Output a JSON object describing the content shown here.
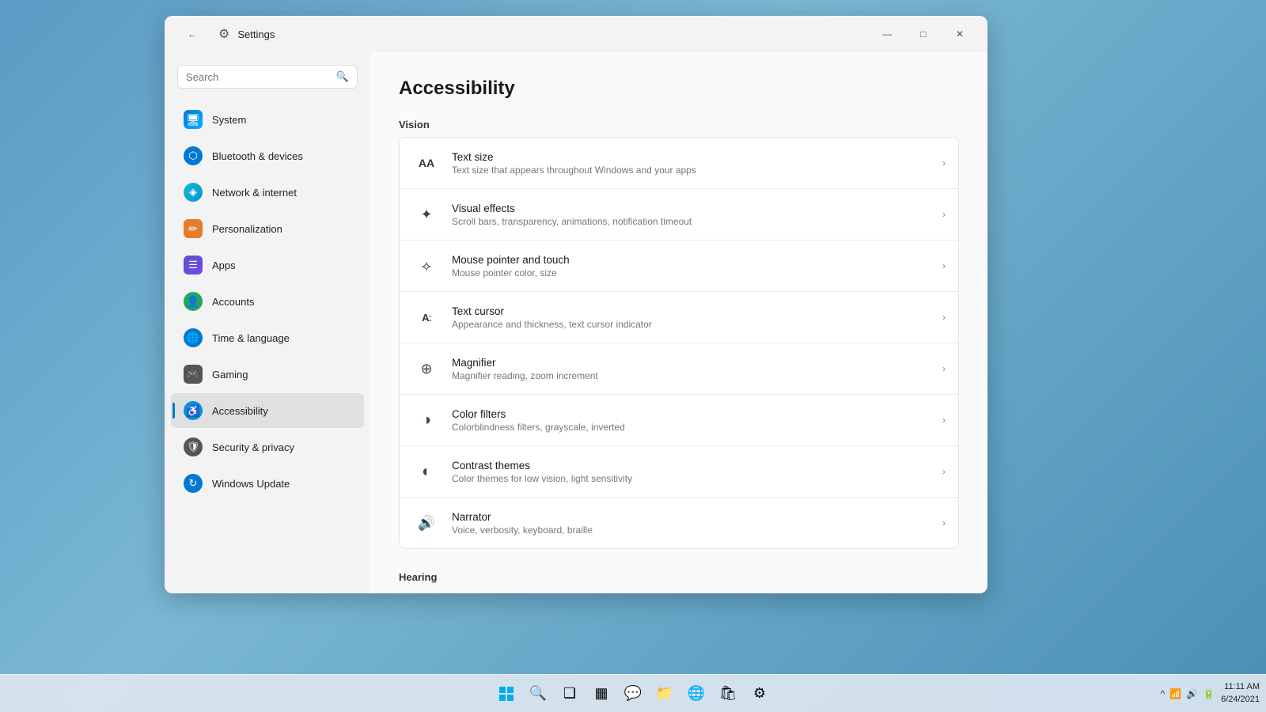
{
  "window": {
    "title": "Settings",
    "controls": {
      "minimize": "—",
      "maximize": "□",
      "close": "✕"
    }
  },
  "sidebar": {
    "search_placeholder": "Search",
    "items": [
      {
        "id": "system",
        "label": "System",
        "icon": "🖥"
      },
      {
        "id": "bluetooth",
        "label": "Bluetooth & devices",
        "icon": "⬡"
      },
      {
        "id": "network",
        "label": "Network & internet",
        "icon": "◈"
      },
      {
        "id": "personalization",
        "label": "Personalization",
        "icon": "✏"
      },
      {
        "id": "apps",
        "label": "Apps",
        "icon": "☰"
      },
      {
        "id": "accounts",
        "label": "Accounts",
        "icon": "👤"
      },
      {
        "id": "time",
        "label": "Time & language",
        "icon": "🌐"
      },
      {
        "id": "gaming",
        "label": "Gaming",
        "icon": "🎮"
      },
      {
        "id": "accessibility",
        "label": "Accessibility",
        "icon": "♿"
      },
      {
        "id": "security",
        "label": "Security & privacy",
        "icon": "🛡"
      },
      {
        "id": "update",
        "label": "Windows Update",
        "icon": "↻"
      }
    ]
  },
  "page": {
    "title": "Accessibility",
    "sections": [
      {
        "id": "vision",
        "label": "Vision",
        "items": [
          {
            "id": "text-size",
            "icon": "AA",
            "icon_type": "text",
            "title": "Text size",
            "description": "Text size that appears throughout Windows and your apps"
          },
          {
            "id": "visual-effects",
            "icon": "✦",
            "icon_type": "symbol",
            "title": "Visual effects",
            "description": "Scroll bars, transparency, animations, notification timeout"
          },
          {
            "id": "mouse-pointer",
            "icon": "⟡",
            "icon_type": "symbol",
            "title": "Mouse pointer and touch",
            "description": "Mouse pointer color, size"
          },
          {
            "id": "text-cursor",
            "icon": "Aː",
            "icon_type": "text",
            "title": "Text cursor",
            "description": "Appearance and thickness, text cursor indicator"
          },
          {
            "id": "magnifier",
            "icon": "⊕",
            "icon_type": "symbol",
            "title": "Magnifier",
            "description": "Magnifier reading, zoom increment"
          },
          {
            "id": "color-filters",
            "icon": "◑",
            "icon_type": "symbol",
            "title": "Color filters",
            "description": "Colorblindness filters, grayscale, inverted"
          },
          {
            "id": "contrast-themes",
            "icon": "◐",
            "icon_type": "symbol",
            "title": "Contrast themes",
            "description": "Color themes for low vision, light sensitivity"
          },
          {
            "id": "narrator",
            "icon": "🔊",
            "icon_type": "symbol",
            "title": "Narrator",
            "description": "Voice, verbosity, keyboard, braille"
          }
        ]
      },
      {
        "id": "hearing",
        "label": "Hearing",
        "items": []
      }
    ]
  },
  "taskbar": {
    "time": "11:11 AM",
    "date": "6/24/2021",
    "icons": [
      {
        "id": "start",
        "symbol": "⊞"
      },
      {
        "id": "search",
        "symbol": "🔍"
      },
      {
        "id": "taskview",
        "symbol": "❏"
      },
      {
        "id": "widgets",
        "symbol": "▦"
      },
      {
        "id": "chat",
        "symbol": "💬"
      },
      {
        "id": "fileexplorer",
        "symbol": "📁"
      },
      {
        "id": "edge",
        "symbol": "🌐"
      },
      {
        "id": "store",
        "symbol": "🛍"
      },
      {
        "id": "settings",
        "symbol": "⚙"
      }
    ],
    "sys_icons": {
      "chevron": "^",
      "wifi": "📶",
      "sound": "🔊",
      "battery": "🔋"
    }
  }
}
